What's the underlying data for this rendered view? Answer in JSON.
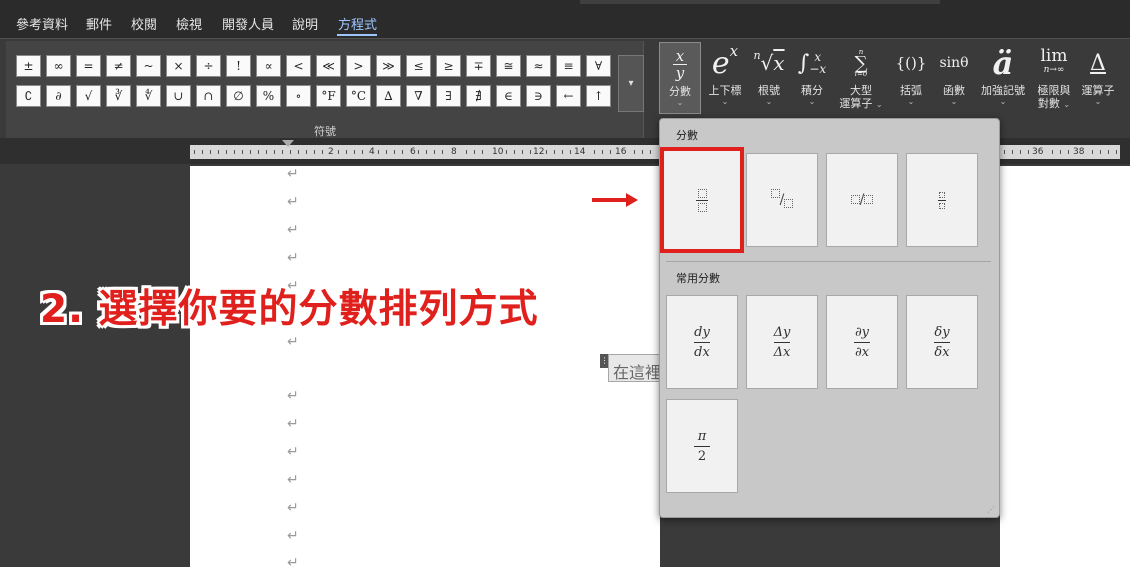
{
  "menu": {
    "items": [
      "參考資料",
      "郵件",
      "校閱",
      "檢視",
      "開發人員",
      "說明",
      "方程式"
    ],
    "active": "方程式"
  },
  "symbols": {
    "row1": [
      "±",
      "∞",
      "=",
      "≠",
      "~",
      "×",
      "÷",
      "!",
      "∝",
      "<",
      "≪",
      ">",
      "≫",
      "≤",
      "≥",
      "∓",
      "≅",
      "≈",
      "≡",
      "∀"
    ],
    "row2": [
      "∁",
      "∂",
      "√",
      "∛",
      "∜",
      "∪",
      "∩",
      "∅",
      "%",
      "∘",
      "°F",
      "°C",
      "∆",
      "∇",
      "∃",
      "∄",
      "∈",
      "∋",
      "←",
      "↑"
    ],
    "more": "▾",
    "group_label": "符號"
  },
  "structures": [
    {
      "glyph": "x/y",
      "label": "分數",
      "selected": true
    },
    {
      "glyph": "eˣ",
      "label": "上下標"
    },
    {
      "glyph": "ⁿ√x",
      "label": "根號"
    },
    {
      "glyph": "∫ˣ₋ₓ",
      "label": "積分"
    },
    {
      "glyph": "∑",
      "label": "大型",
      "label2": "運算子"
    },
    {
      "glyph": "{()}",
      "label": "括弧"
    },
    {
      "glyph": "sinθ",
      "label": "函數"
    },
    {
      "glyph": "ä",
      "label": "加強記號"
    },
    {
      "glyph": "lim",
      "sub": "n→∞",
      "label": "極限與",
      "label2": "對數"
    },
    {
      "glyph": "Δ",
      "label": "運算子"
    }
  ],
  "ruler": {
    "numbers": [
      "2",
      "4",
      "6",
      "8",
      "10",
      "12",
      "14",
      "16"
    ],
    "numbers_right": [
      "36",
      "38"
    ]
  },
  "document": {
    "equation_placeholder": "在這裡"
  },
  "annotation": {
    "text": "2. 選擇你要的分數排列方式"
  },
  "dropdown": {
    "section1_title": "分數",
    "section2_title": "常用分數",
    "common": [
      {
        "num": "dy",
        "den": "dx"
      },
      {
        "num": "Δy",
        "den": "Δx"
      },
      {
        "num": "∂y",
        "den": "∂x"
      },
      {
        "num": "δy",
        "den": "δx"
      },
      {
        "num": "π",
        "den": "2"
      }
    ]
  },
  "colors": {
    "accent": "#9fc5ff",
    "highlight": "#e0201c",
    "annotation": "#e0201c"
  }
}
